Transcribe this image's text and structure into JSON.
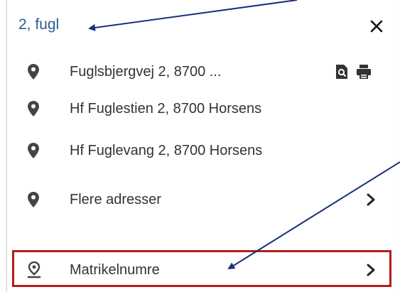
{
  "search": {
    "value": "2, fugl",
    "close_icon": "close-icon"
  },
  "results": [
    {
      "label": "Fuglsbjergvej 2, 8700 ...",
      "icon": "location-pin-icon",
      "actions": [
        "document-search-icon",
        "print-icon"
      ]
    },
    {
      "label": "Hf Fuglestien 2, 8700 Horsens",
      "icon": "location-pin-icon"
    },
    {
      "label": "Hf Fuglevang 2, 8700 Horsens",
      "icon": "location-pin-icon"
    }
  ],
  "more": {
    "label": "Flere adresser",
    "icon": "location-pin-icon",
    "chevron": "chevron-right-icon"
  },
  "cadastral": {
    "label": "Matrikelnumre",
    "icon": "parcel-pin-icon",
    "chevron": "chevron-right-icon",
    "highlighted": true
  },
  "colors": {
    "input_text": "#2c5b92",
    "item_text": "#333333",
    "icon": "#444444",
    "highlight_border": "#b01e1e",
    "annotation_arrow": "#1a2e7a"
  }
}
